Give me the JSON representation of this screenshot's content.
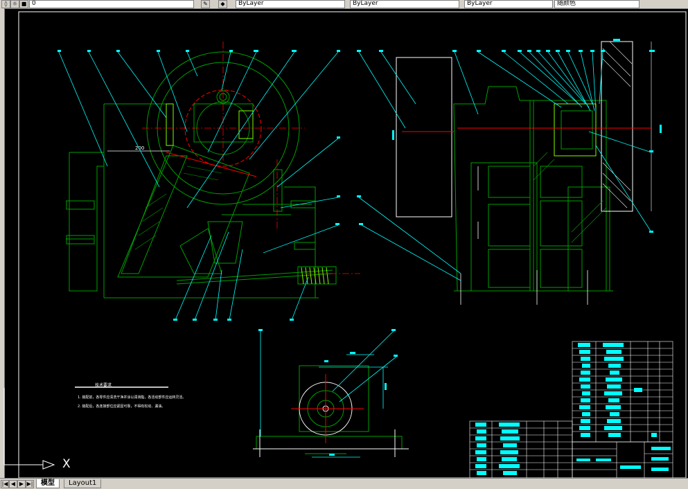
{
  "toolbar": {
    "layer_value": "0",
    "bylayer_1": "ByLayer",
    "bylayer_2": "ByLayer",
    "bylayer_3": "ByLayer",
    "color_value": "随颜色"
  },
  "drawing": {
    "dim_200": "200",
    "tech_title": "技术要求",
    "tech_note_1": "1. 装配前，各零件应清洗干净并涂以润滑脂，各活动部件应运转灵活。",
    "tech_note_2": "2. 装配后，各连接部位应紧固可靠，不得有松动、漏油。"
  },
  "ucs": {
    "x_label": "X"
  },
  "tabs": [
    "模型",
    "Layout1"
  ],
  "colors": {
    "background": "#000000",
    "green": "#00a000",
    "cyan": "#00ffff",
    "red": "#ff0000",
    "white": "#ffffff",
    "yellow_green": "#80ff00"
  }
}
